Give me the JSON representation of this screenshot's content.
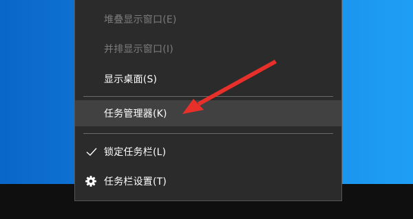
{
  "context_menu": {
    "items": [
      {
        "label": "堆叠显示窗口(E)",
        "enabled": false
      },
      {
        "label": "并排显示窗口(I)",
        "enabled": false
      },
      {
        "label": "显示桌面(S)",
        "enabled": true
      },
      {
        "label": "任务管理器(K)",
        "enabled": true,
        "highlighted": true
      },
      {
        "label": "锁定任务栏(L)",
        "enabled": true,
        "checked": true,
        "icon": "checkmark-icon"
      },
      {
        "label": "任务栏设置(T)",
        "enabled": true,
        "icon": "gear-icon"
      }
    ]
  },
  "annotation": {
    "color": "#e8302a",
    "points_to": "任务管理器(K)"
  },
  "colors": {
    "menu_background": "#2b2b2b",
    "menu_hover": "#414141",
    "disabled_text": "#7c7c7c",
    "desktop_blue": "#1282e0",
    "taskbar": "#0f0f10"
  }
}
